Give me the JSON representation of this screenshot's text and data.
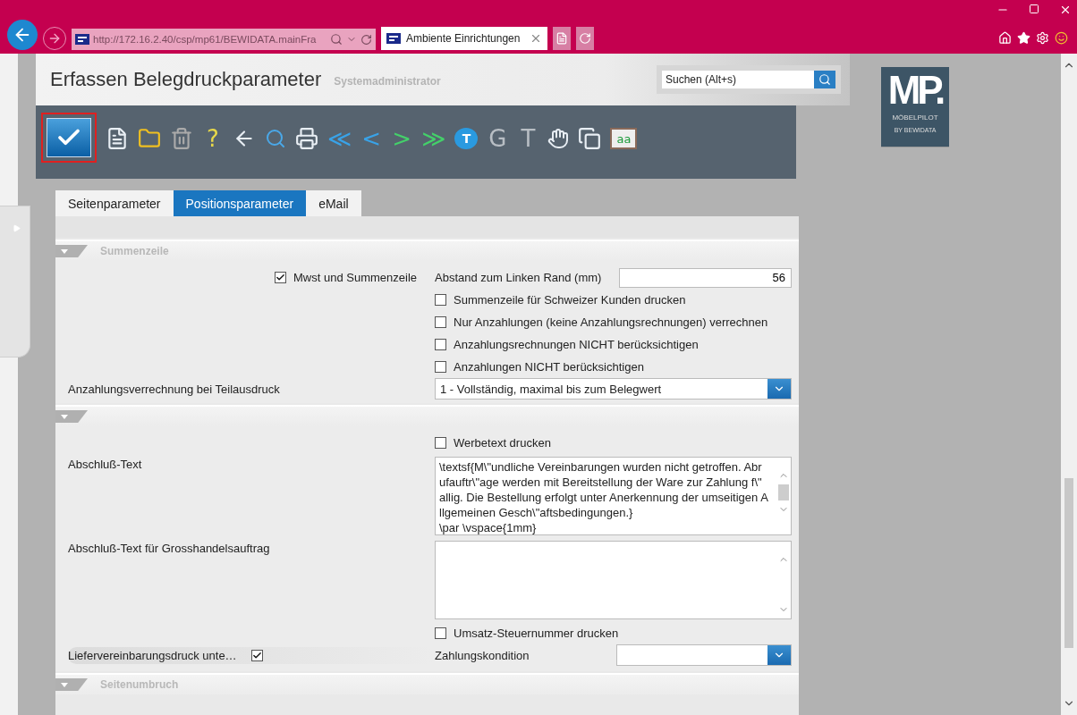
{
  "browser": {
    "url": "http://172.16.2.40/csp/mp61/BEWIDATA.mainFra",
    "tab_title": "Ambiente Einrichtungen"
  },
  "header": {
    "title": "Erfassen Belegdruckparameter",
    "user": "Systemadministrator",
    "search": {
      "placeholder": "Suchen (Alt+s)"
    }
  },
  "logo": {
    "letters": "MP.",
    "name": "MÖBELPILOT",
    "tagline": "BY BEWIDATA"
  },
  "toolbar": [
    {
      "kind": "save",
      "selected": true
    },
    {
      "kind": "page"
    },
    {
      "kind": "folder"
    },
    {
      "kind": "trash"
    },
    {
      "kind": "glyph",
      "label": "?",
      "color": "#e8d84a"
    },
    {
      "kind": "back"
    },
    {
      "kind": "magnifier"
    },
    {
      "kind": "printer"
    },
    {
      "kind": "glyph",
      "label": "≪",
      "color": "#39a3e8"
    },
    {
      "kind": "glyph",
      "label": "<",
      "color": "#39a3e8"
    },
    {
      "kind": "glyph",
      "label": ">",
      "color": "#44d06a"
    },
    {
      "kind": "glyph",
      "label": "≫",
      "color": "#44d06a"
    },
    {
      "kind": "bubble",
      "label": "T"
    },
    {
      "kind": "glyph",
      "label": "G",
      "color": "#b8bec4"
    },
    {
      "kind": "glyph",
      "label": "T",
      "color": "#b8bec4"
    },
    {
      "kind": "hand-page"
    },
    {
      "kind": "copy"
    },
    {
      "kind": "book",
      "label": "aa"
    }
  ],
  "tabs": [
    {
      "label": "Seitenparameter",
      "selected": false
    },
    {
      "label": "Positionsparameter",
      "selected": true
    },
    {
      "label": "eMail",
      "selected": false
    }
  ],
  "summenzeile": {
    "title": "Summenzeile",
    "mwst": {
      "label": "Mwst und Summenzeile",
      "checked": true
    },
    "abstand": {
      "label": "Abstand zum Linken Rand (mm)",
      "value": "56"
    },
    "options": [
      {
        "label": "Summenzeile für Schweizer Kunden drucken",
        "checked": false
      },
      {
        "label": "Nur Anzahlungen (keine Anzahlungsrechnungen) verrechnen",
        "checked": false
      },
      {
        "label": "Anzahlungsrechnungen NICHT berücksichtigen",
        "checked": false
      },
      {
        "label": "Anzahlungen NICHT berücksichtigen",
        "checked": false
      }
    ],
    "verrechnung": {
      "label": "Anzahlungsverrechnung bei Teilausdruck",
      "value": "1 - Vollständig, maximal bis zum Belegwert"
    }
  },
  "abschluss": {
    "werbetext": {
      "label": "Werbetext drucken",
      "checked": false
    },
    "text": {
      "label": "Abschluß-Text",
      "lines": [
        "\\textsf{M\\\"undliche Vereinbarungen wurden nicht getroffen. Abr",
        "ufauftr\\\"age werden mit Bereitstellung der Ware zur Zahlung f\\\"",
        "allig. Die Bestellung erfolgt unter Anerkennung der umseitigen A",
        "llgemeinen Gesch\\\"aftsbedingungen.}",
        "\\par \\vspace{1mm}"
      ]
    },
    "grosshandel": {
      "label": "Abschluß-Text für Grosshandelsauftrag"
    },
    "umsatz": {
      "label": "Umsatz-Steuernummer drucken",
      "checked": false
    },
    "liefer": {
      "label": "Liefervereinbarungsdruck unte…",
      "checked": true
    },
    "zahlung": {
      "label": "Zahlungskondition"
    }
  },
  "seitenumbruch": {
    "title": "Seitenumbruch"
  }
}
